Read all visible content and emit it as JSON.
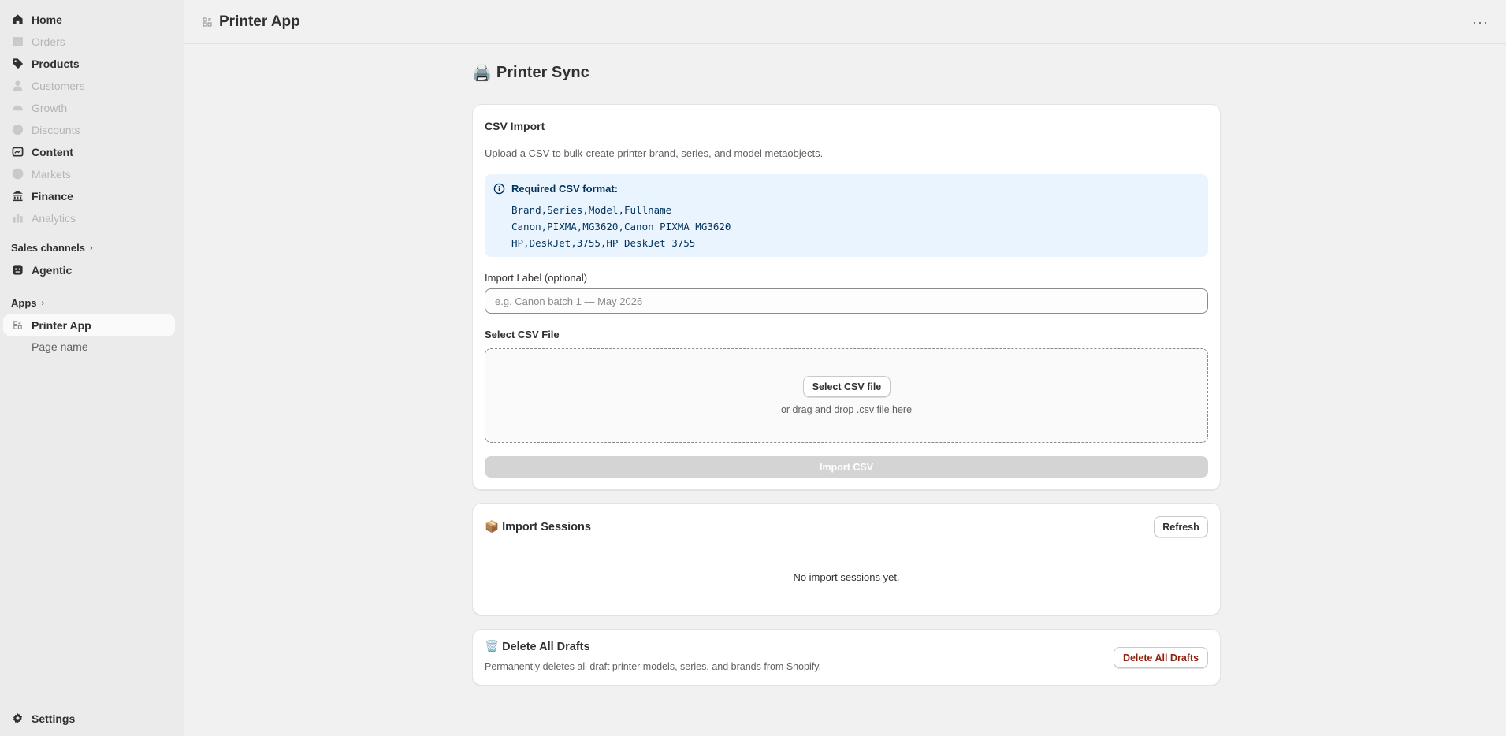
{
  "sidebar": {
    "items": [
      {
        "label": "Home",
        "icon": "home-icon",
        "enabled": true
      },
      {
        "label": "Orders",
        "icon": "inbox-icon",
        "enabled": false
      },
      {
        "label": "Products",
        "icon": "tag-icon",
        "enabled": true
      },
      {
        "label": "Customers",
        "icon": "person-icon",
        "enabled": false
      },
      {
        "label": "Growth",
        "icon": "gauge-icon",
        "enabled": false
      },
      {
        "label": "Discounts",
        "icon": "discount-icon",
        "enabled": false
      },
      {
        "label": "Content",
        "icon": "content-icon",
        "enabled": true
      },
      {
        "label": "Markets",
        "icon": "globe-icon",
        "enabled": false
      },
      {
        "label": "Finance",
        "icon": "bank-icon",
        "enabled": true
      },
      {
        "label": "Analytics",
        "icon": "chart-icon",
        "enabled": false
      }
    ],
    "sales_channels_label": "Sales channels",
    "agentic_label": "Agentic",
    "apps_label": "Apps",
    "printer_app_label": "Printer App",
    "page_name_label": "Page name",
    "settings_label": "Settings"
  },
  "header": {
    "title": "Printer App"
  },
  "main": {
    "page_title": "Printer Sync",
    "page_title_emoji": "🖨️",
    "csv_import": {
      "title": "CSV Import",
      "description": "Upload a CSV to bulk-create printer brand, series, and model metaobjects.",
      "format_title": "Required CSV format:",
      "format_lines": [
        "Brand,Series,Model,Fullname",
        "Canon,PIXMA,MG3620,Canon PIXMA MG3620",
        "HP,DeskJet,3755,HP DeskJet 3755"
      ],
      "label_field_label": "Import Label (optional)",
      "label_field_placeholder": "e.g. Canon batch 1 — May 2026",
      "label_field_value": "",
      "file_label": "Select CSV File",
      "select_button": "Select CSV file",
      "drop_hint": "or drag and drop .csv file here",
      "import_button": "Import CSV"
    },
    "sessions": {
      "emoji": "📦",
      "title": "Import Sessions",
      "refresh_button": "Refresh",
      "empty_text": "No import sessions yet."
    },
    "delete_drafts": {
      "emoji": "🗑️",
      "title": "Delete All Drafts",
      "description": "Permanently deletes all draft printer models, series, and brands from Shopify.",
      "button": "Delete All Drafts"
    }
  },
  "colors": {
    "info_bg": "#eaf4ff",
    "info_text": "#00325a",
    "danger_text": "#8e1f0b",
    "disabled_button": "#d4d4d4"
  }
}
